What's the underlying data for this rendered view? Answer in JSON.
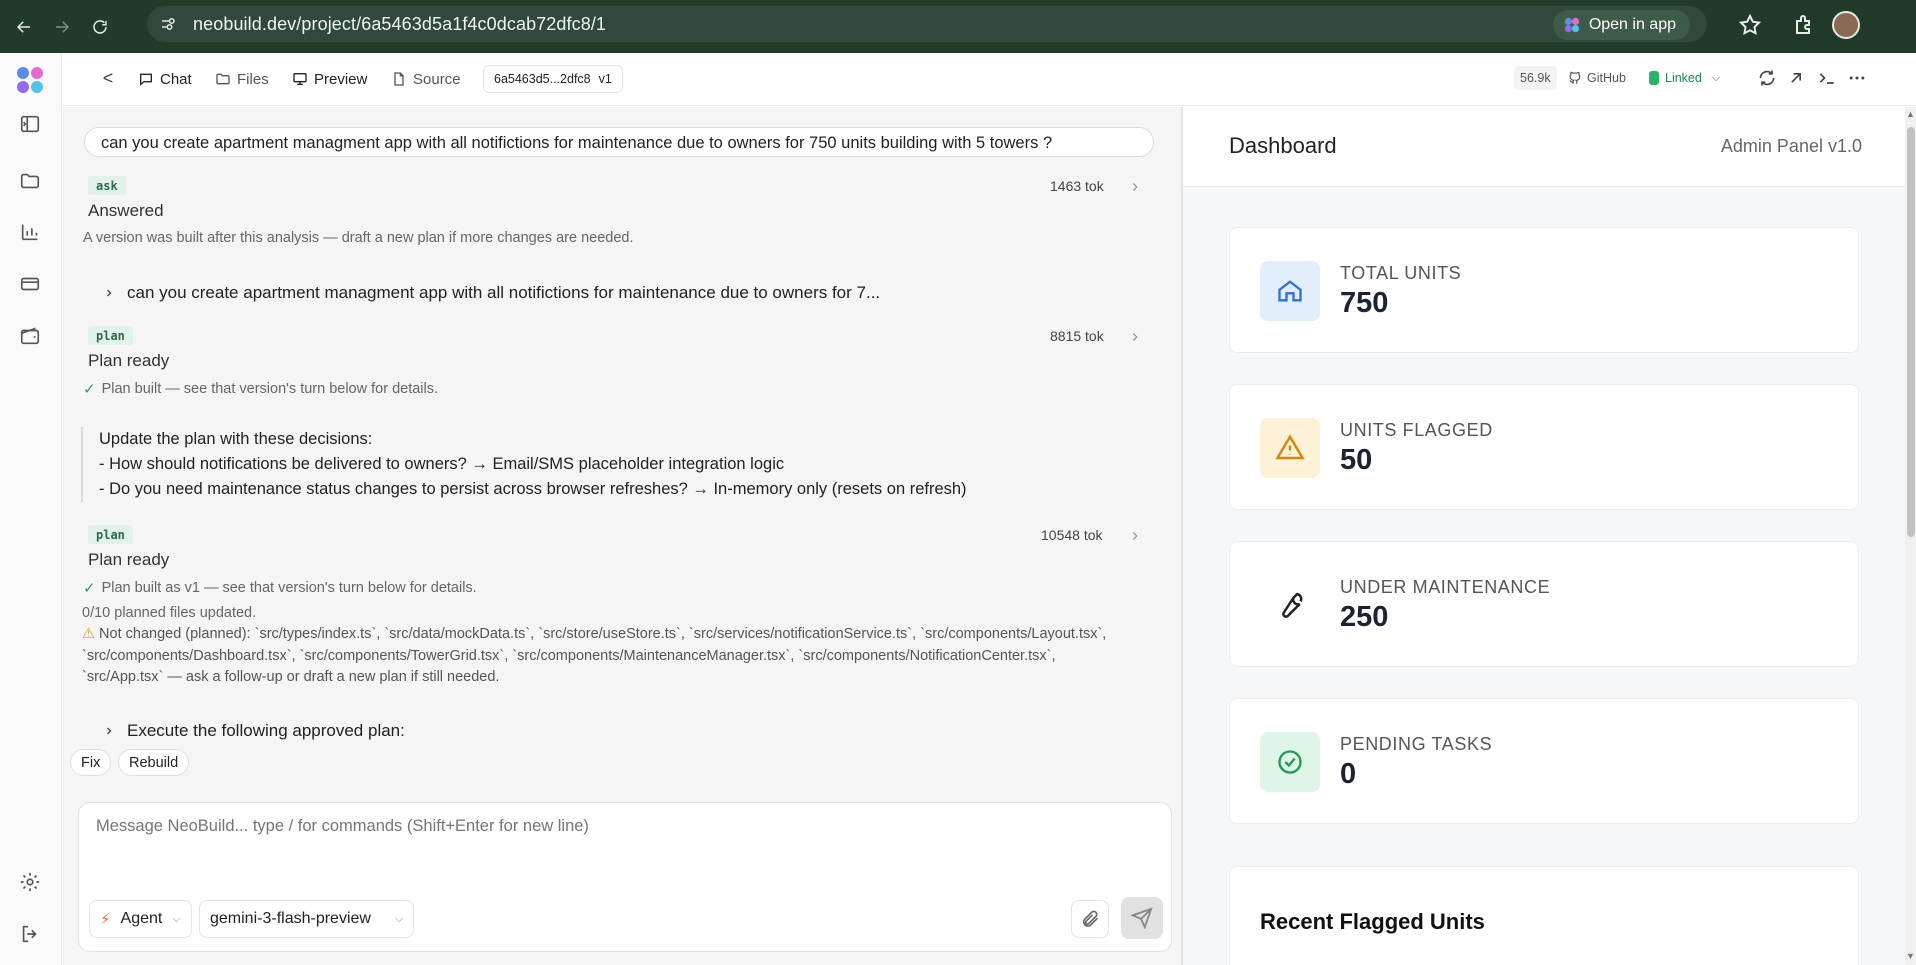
{
  "browser": {
    "url": "neobuild.dev/project/6a5463d5a1f4c0dcab72dfc8/1",
    "open_in_app": "Open in app"
  },
  "toolbar": {
    "back": "<",
    "tabs": [
      {
        "label": "Chat",
        "icon": "chat-icon",
        "active": true
      },
      {
        "label": "Files",
        "icon": "folder-icon",
        "active": false
      },
      {
        "label": "Preview",
        "icon": "monitor-icon",
        "active": true
      },
      {
        "label": "Source",
        "icon": "file-icon",
        "active": false
      }
    ],
    "project_id": "6a5463d5...2dfc8",
    "version": "v1",
    "tokens": "56.9k",
    "github": "GitHub",
    "linked": "Linked"
  },
  "chat": {
    "user_prompt": "can you create apartment managment app with all notifictions for maintenance due to owners for 750 units building with 5 towers ?",
    "turns": [
      {
        "tag": "ask",
        "status": "Answered",
        "tokens": "1463 tok",
        "note": "A version was built after this analysis — draft a new plan if more changes are needed."
      },
      {
        "collapsed_prompt": "can you create apartment managment app with all notifictions for maintenance due to owners for 7..."
      },
      {
        "tag": "plan",
        "status": "Plan ready",
        "tokens": "8815 tok",
        "note": "Plan built — see that version's turn below for details."
      },
      {
        "decisions": [
          "Update the plan with these decisions:",
          "- How should notifications be delivered to owners? → Email/SMS placeholder integration logic",
          "- Do you need maintenance status changes to persist across browser refreshes? → In-memory only (resets on refresh)"
        ]
      },
      {
        "tag": "plan",
        "status": "Plan ready",
        "tokens": "10548 tok",
        "note": "Plan built as v1 — see that version's turn below for details.",
        "files_updated": "0/10 planned files updated.",
        "not_changed": "Not changed (planned): `src/types/index.ts`, `src/data/mockData.ts`, `src/store/useStore.ts`, `src/services/notificationService.ts`, `src/components/Layout.tsx`, `src/components/Dashboard.tsx`, `src/components/TowerGrid.tsx`, `src/components/MaintenanceManager.tsx`, `src/components/NotificationCenter.tsx`, `src/App.tsx` — ask a follow-up or draft a new plan if still needed."
      },
      {
        "collapsed_prompt": "Execute the following approved plan:"
      }
    ],
    "quick_actions": [
      "Fix",
      "Rebuild"
    ],
    "composer": {
      "placeholder": "Message NeoBuild... type / for commands (Shift+Enter for new line)",
      "mode": "Agent",
      "model": "gemini-3-flash-preview"
    }
  },
  "preview": {
    "title": "Dashboard",
    "subtitle": "Admin Panel v1.0",
    "stats": [
      {
        "label": "TOTAL UNITS",
        "value": "750",
        "icon": "home-icon",
        "bg": "#e3eefc",
        "fg": "#2f6fd6"
      },
      {
        "label": "UNITS FLAGGED",
        "value": "50",
        "icon": "warning-icon",
        "bg": "#fdf1d7",
        "fg": "#d08a0e"
      },
      {
        "label": "UNDER MAINTENANCE",
        "value": "250",
        "icon": "wrench-icon",
        "bg": "#ffffff",
        "fg": "#222222"
      },
      {
        "label": "PENDING TASKS",
        "value": "0",
        "icon": "check-circle-icon",
        "bg": "#dff5e8",
        "fg": "#1f9a55"
      }
    ],
    "recent_title": "Recent Flagged Units"
  }
}
